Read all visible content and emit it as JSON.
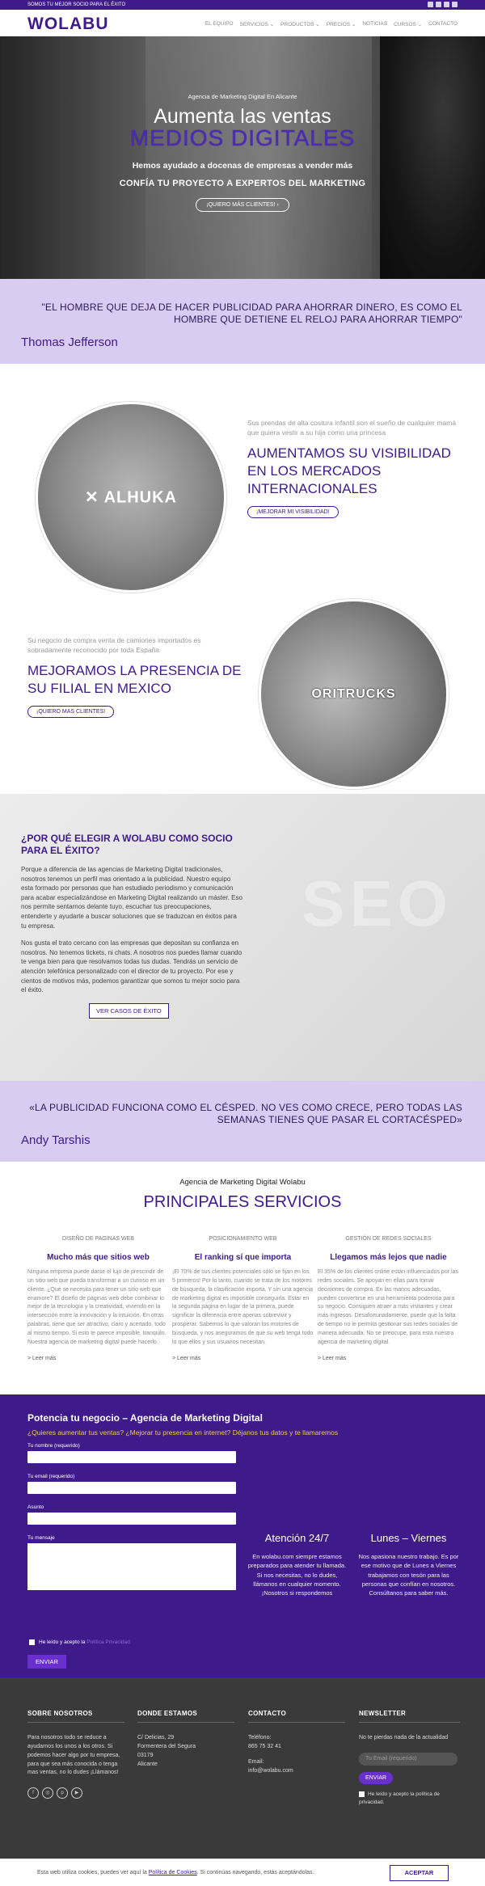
{
  "topbar": {
    "text": "SOMOS TU MEJOR SOCIO PARA EL ÉXITO"
  },
  "nav": {
    "logo": "WOLABU",
    "items": [
      "EL EQUIPO",
      "SERVICIOS ⌄",
      "PRODUCTOS ⌄",
      "PRECIOS ⌄",
      "NOTICIAS",
      "CURSOS ⌄",
      "CONTACTO"
    ]
  },
  "hero": {
    "sub": "Agencia de Marketing Digital En Alicante",
    "title": "Aumenta las ventas",
    "blue": "MEDIOS DIGITALES",
    "help": "Hemos ayudado a docenas de empresas a vender más",
    "confia": "CONFÍA TU PROYECTO A EXPERTOS DEL MARKETING",
    "cta": "¡QUIERO MÁS CLIENTES!   ›"
  },
  "quote1": {
    "text": "\"EL HOMBRE QUE DEJA DE HACER PUBLICIDAD PARA AHORRAR DINERO, ES COMO EL HOMBRE QUE DETIENE EL RELOJ PARA AHORRAR TIEMPO\"",
    "author": "Thomas Jefferson"
  },
  "feature1": {
    "brand": "ALHUKA",
    "desc": "Sus prendas de alta costura infantil son el sueño de cualquier mamá que quiera vestir a su hija como una princesa",
    "heading": "AUMENTAMOS SU VISIBILIDAD EN LOS MERCADOS INTERNACIONALES",
    "cta": "¡MEJORAR MI VISIBILIDAD!"
  },
  "feature2": {
    "brand": "ORITRUCKS",
    "desc": "Su negocio de compra venta de camiones importados es sobradamente reconocido por toda España",
    "heading": "MEJORAMOS LA PRESENCIA DE SU FILIAL EN MEXICO",
    "cta": "¡QUIERO MAS CLIENTES!"
  },
  "why": {
    "title": "¿POR QUÉ ELEGIR A WOLABU COMO SOCIO PARA EL ÉXITO?",
    "p1": "Porque a diferencia de las agencias de Marketing Digital tradicionales, nosotros tenemos un perfil mas orientado a la publicidad. Nuestro equipo esta formado por personas que han estudiado periodismo y comunicación para acabar especializándose en Marketing Digital realizando un máster. Eso nos permite sentarnos delante tuyo, escuchar tus preocupaciones, entenderte y ayudarte a buscar soluciones que se traduzcan en éxitos para tu empresa.",
    "p2": "Nos gusta el trato cercano con las empresas que depositan su confianza en nosotros. No tenemos tickets, ni chats. A nosotros nos puedes llamar cuando te venga bien para que resolvamos todas tus dudas. Tendrás un servicio de atención telefónica personalizado con el director de tu proyecto. Por ese y cientos de motivos más, podemos garantizar que somos tu mejor socio para el éxito.",
    "cta": "VER CASOS DE ÉXITO"
  },
  "quote2": {
    "text": "«LA PUBLICIDAD FUNCIONA COMO EL CÉSPED. NO VES COMO CRECE, PERO TODAS LAS SEMANAS TIENES QUE PASAR EL CORTACÉSPED»",
    "author": "Andy Tarshis"
  },
  "services": {
    "sub": "Agencia de Marketing Digital Wolabu",
    "title": "PRINCIPALES SERVICIOS",
    "items": [
      {
        "tag": "DISEÑO DE PAGINAS WEB",
        "h": "Mucho más que sitios web",
        "p": "Ninguna empresa puede darse el lujo de prescindir de un sitio web que pueda transformar a un curioso en un cliente. ¿Qué se necesita para tener un sitio web que enamore? El diseño de páginas web debe combinar lo mejor de la tecnología y la creatividad, viviendo en la intersección entre la innovación y la intuición. En otras palabras, tiene que ser atractivo, claro y acertado, todo al mismo tiempo. Si esto te parece imposible, tranquilo. Nuestra agencia de marketing digital puede hacerlo.",
        "more": "> Leer más"
      },
      {
        "tag": "POSICIONAMIENTO WEB",
        "h": "El ranking sí que importa",
        "p": "¡El 70% de sus clientes potenciales sólo se fijan en los 5 primeros! Por lo tanto, cuando se trata de los motores de búsqueda, la clasificación importa. Y sin una agencia de marketing digital es imposible conseguirla. Estar en la segunda página en lugar de la primera, puede significar la diferencia entre apenas sobrevivir y prosperar. Sabemos lo que valoran los motores de búsqueda, y nos aseguramos de que su web tenga todo lo que ellos y sus usuarios necesitan.",
        "more": "> Leer más"
      },
      {
        "tag": "GESTIÓN DE REDES SOCIALES",
        "h": "Llegamos más lejos que nadie",
        "p": "El 35% de los clientes online están influenciados por las redes sociales. Se apoyan en ellas para tomar decisiones de compra. En las manos adecuadas, pueden convertirse en una herramienta poderosa para su negocio. Consiguen atraer a más visitantes y crear más ingresos. Desafortunadamente, puede que la falta de tiempo no le permita gestionar sus redes sociales de manera adecuada. No se preocupe, para esta nuestra agencia de marketing digital.",
        "more": "> Leer más"
      }
    ]
  },
  "form": {
    "title": "Potencia tu negocio – Agencia de Marketing Digital",
    "yellow": "¿Quieres aumentar tus ventas? ¿Mejorar tu presencia en internet? Déjanos tus datos y te llamaremos",
    "name": "Tu nombre (requerido)",
    "email": "Tu email (requerido)",
    "subject": "Asunto",
    "message": "Tu mensaje",
    "consent_pre": "He leído y acepto la ",
    "consent_link": "Política Privacidad",
    "send": "ENVIAR"
  },
  "info": [
    {
      "h": "Atención 24/7",
      "p": "En wolabu.com siempre estamos preparados para atender tu llamada. Si nos necesitas, no lo dudes, llámanos en cualquier momento. ¡Nosotros si respondemos"
    },
    {
      "h": "Lunes – Viernes",
      "p": "Nos apasiona nuestro trabajo. Es por ese motivo que de Lunes a Viernes trabajamos con tesón para las personas que confían en nosotros. Consúltanos para saber más."
    }
  ],
  "footer": {
    "about": {
      "h": "SOBRE NOSOTROS",
      "p": "Para nosotros todo se reduce a ayudarnos los unos a los otros. Si podemos hacer algo por tu empresa, para que sea más conocida o tenga mas ventas, no lo dudes ¡Llámanos!"
    },
    "where": {
      "h": "DONDE ESTAMOS",
      "p": "C/ Delicias, 29\nFormentera del Segura\n03179\nAlicante"
    },
    "contact": {
      "h": "CONTACTO",
      "phone_label": "Teléfono:",
      "phone": "865 75 32 41",
      "email_label": "Email:",
      "email": "info@wolabu.com"
    },
    "news": {
      "h": "NEWSLETTER",
      "p": "No te pierdas nada de la actualidad",
      "placeholder": "Tu Email (requerido)",
      "send": "ENVIAR",
      "consent": "He leído y acepto la política de privacidad."
    }
  },
  "cookie": {
    "pre": "Esta web utiliza cookies, puedes ver aquí la ",
    "link": "Política de Cookies",
    "post": ". Si continúas navegando, estás aceptándolas.",
    "btn": "ACEPTAR"
  },
  "colors": {
    "brand": "#3e1a8a",
    "quoteBg": "#d9ccf2",
    "yellow": "#f2c94c"
  }
}
